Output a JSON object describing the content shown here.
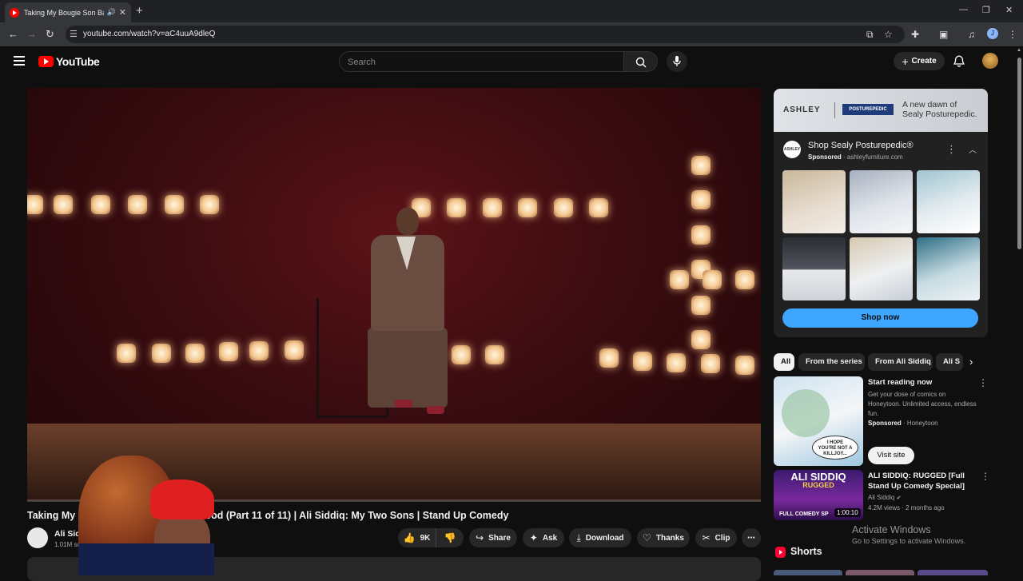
{
  "browser": {
    "tab_title": "Taking My Bougie Son Back",
    "url": "youtube.com/watch?v=aC4uuA9dleQ",
    "profile_initial": "J"
  },
  "header": {
    "logo": "YouTube",
    "search_placeholder": "Search",
    "create_label": "Create"
  },
  "video": {
    "title": "Taking My Bougie Son Back To The Hood (Part 11 of 11) | Ali Siddiq: My Two Sons | Stand Up Comedy",
    "channel": "Ali Siddiq",
    "subscribers": "1.01M subscribers",
    "progress_fraction": 0.0,
    "actions": {
      "likes": "9K",
      "share": "Share",
      "ask": "Ask",
      "download": "Download",
      "thanks": "Thanks",
      "clip": "Clip"
    }
  },
  "ad": {
    "brand": "ASHLEY",
    "partner": "POSTUREPEDIC",
    "tagline_1": "A new dawn of",
    "tagline_2": "Sealy Posturepedic.",
    "logo_text": "ASHLEY",
    "title": "Shop Sealy Posturepedic®",
    "sponsored": "Sponsored",
    "domain": "· ashleyfurniture.com",
    "cta": "Shop now"
  },
  "chips": [
    "All",
    "From the series",
    "From Ali Siddiq",
    "Ali S"
  ],
  "related": [
    {
      "title": "Start reading now",
      "description": "Get your dose of comics on Honeytoon. Unlimited access, endless fun.",
      "sponsored": "Sponsored",
      "advertiser": "· Honeytoon",
      "cta": "Visit site",
      "thumb_text_1": "I HOPE",
      "thumb_text_2": "YOU'RE NOT A",
      "thumb_text_3": "KILLJOY..."
    },
    {
      "title": "ALI SIDDIQ: RUGGED [Full Stand Up Comedy Special]",
      "channel": "Ali Siddiq",
      "stats": "4.2M views · 2 months ago",
      "duration": "1:00:10",
      "thumb_text_1": "ALI SIDDIQ",
      "thumb_text_2": "RUGGED",
      "thumb_text_3": "FULL COMEDY SP"
    }
  ],
  "watermark": {
    "line1": "Activate Windows",
    "line2": "Go to Settings to activate Windows."
  },
  "shorts_label": "Shorts",
  "colors": {
    "background": "#0f0f0f",
    "accent": "#ff0000",
    "shop_button": "#3ea6ff"
  }
}
